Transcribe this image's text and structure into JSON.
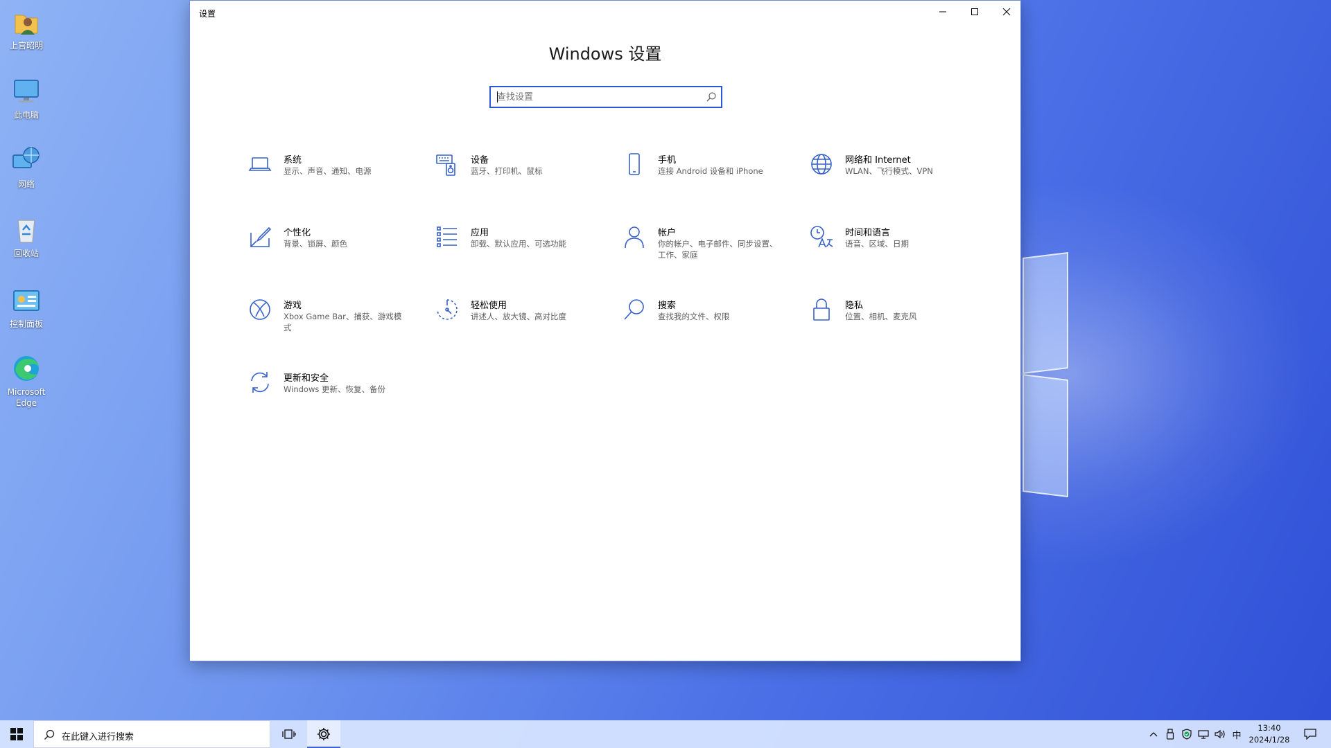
{
  "desktop": {
    "icons": [
      {
        "label": "上官昭明",
        "icon": "user-folder-icon"
      },
      {
        "label": "此电脑",
        "icon": "computer-icon"
      },
      {
        "label": "网络",
        "icon": "network-globe-icon"
      },
      {
        "label": "回收站",
        "icon": "recycle-bin-icon"
      },
      {
        "label": "控制面板",
        "icon": "control-panel-icon"
      },
      {
        "label": "Microsoft Edge",
        "icon": "edge-icon"
      }
    ]
  },
  "window": {
    "title": "设置",
    "heading": "Windows 设置",
    "search": {
      "placeholder": "查找设置",
      "value": ""
    },
    "controls": {
      "minimize": "minimize-icon",
      "maximize": "maximize-icon",
      "close": "close-icon"
    }
  },
  "tiles": [
    {
      "name": "系统",
      "desc": "显示、声音、通知、电源",
      "icon": "laptop-icon"
    },
    {
      "name": "设备",
      "desc": "蓝牙、打印机、鼠标",
      "icon": "keyboard-speaker-icon"
    },
    {
      "name": "手机",
      "desc": "连接 Android 设备和 iPhone",
      "icon": "phone-icon"
    },
    {
      "name": "网络和 Internet",
      "desc": "WLAN、飞行模式、VPN",
      "icon": "globe-icon"
    },
    {
      "name": "个性化",
      "desc": "背景、锁屏、颜色",
      "icon": "paint-brush-icon"
    },
    {
      "name": "应用",
      "desc": "卸载、默认应用、可选功能",
      "icon": "apps-list-icon"
    },
    {
      "name": "帐户",
      "desc": "你的帐户、电子邮件、同步设置、工作、家庭",
      "icon": "person-icon"
    },
    {
      "name": "时间和语言",
      "desc": "语音、区域、日期",
      "icon": "time-language-icon"
    },
    {
      "name": "游戏",
      "desc": "Xbox Game Bar、捕获、游戏模式",
      "icon": "xbox-icon"
    },
    {
      "name": "轻松使用",
      "desc": "讲述人、放大镜、高对比度",
      "icon": "ease-of-access-icon"
    },
    {
      "name": "搜索",
      "desc": "查找我的文件、权限",
      "icon": "search-icon"
    },
    {
      "name": "隐私",
      "desc": "位置、相机、麦克风",
      "icon": "lock-icon"
    },
    {
      "name": "更新和安全",
      "desc": "Windows 更新、恢复、备份",
      "icon": "sync-arrows-icon"
    }
  ],
  "taskbar": {
    "search_placeholder": "在此键入进行搜索",
    "ime": "中",
    "time": "13:40",
    "date": "2024/1/28",
    "icons": [
      "windows-start-icon",
      "search-icon",
      "task-view-icon",
      "settings-gear-icon",
      "chevron-up-icon",
      "usb-icon",
      "defender-shield-icon",
      "network-icon",
      "volume-icon",
      "notification-icon"
    ]
  },
  "colors": {
    "accent": "#2b56d8",
    "icon_blue": "#3560c9",
    "desktop_blue": "#4a6fe6",
    "taskbar": "#d6e4ff"
  }
}
